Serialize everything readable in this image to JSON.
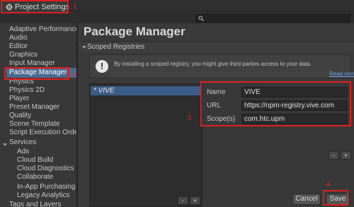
{
  "window": {
    "title": "Project Settings"
  },
  "search": {
    "placeholder": ""
  },
  "sidebar": {
    "items": [
      {
        "label": "Adaptive Performance",
        "sub": false
      },
      {
        "label": "Audio",
        "sub": false
      },
      {
        "label": "Editor",
        "sub": false
      },
      {
        "label": "Graphics",
        "sub": false
      },
      {
        "label": "Input Manager",
        "sub": false
      },
      {
        "label": "Package Manager",
        "sub": false,
        "selected": true
      },
      {
        "label": "Physics",
        "sub": false
      },
      {
        "label": "Physics 2D",
        "sub": false
      },
      {
        "label": "Player",
        "sub": false
      },
      {
        "label": "Preset Manager",
        "sub": false
      },
      {
        "label": "Quality",
        "sub": false
      },
      {
        "label": "Scene Template",
        "sub": false
      },
      {
        "label": "Script Execution Orde",
        "sub": false
      },
      {
        "label": "Services",
        "sub": false,
        "expanded": true
      },
      {
        "label": "Ads",
        "sub": true
      },
      {
        "label": "Cloud Build",
        "sub": true
      },
      {
        "label": "Cloud Diagnostics",
        "sub": true
      },
      {
        "label": "Collaborate",
        "sub": true
      },
      {
        "label": "In-App Purchasing",
        "sub": true
      },
      {
        "label": "Legacy Analytics",
        "sub": true
      },
      {
        "label": "Tags and Layers",
        "sub": false
      }
    ]
  },
  "main": {
    "title": "Package Manager",
    "section_title": "Scoped Registries",
    "info": {
      "icon": "exclamation-icon",
      "text": "By installing a scoped registry, you might give third parties access to your data.",
      "read_more": "Read more"
    },
    "registry_list": {
      "items": [
        "* VIVE"
      ]
    },
    "list_buttons": {
      "remove": "-",
      "add": "+"
    },
    "details": {
      "name_label": "Name",
      "name_value": "VIVE",
      "url_label": "URL",
      "url_value": "https://npm-registry.vive.com",
      "scopes_label": "Scope(s)",
      "scopes_value": "com.htc.upm"
    },
    "scope_buttons": {
      "remove": "-",
      "add": "+"
    },
    "cancel_label": "Cancel",
    "save_label": "Save"
  },
  "annotations": {
    "n1": "1",
    "n2": "2",
    "n3": "3",
    "n4": "4"
  },
  "colors": {
    "annotation_red": "#e01e1e",
    "selection_blue": "#4d6a8e",
    "link_blue": "#6fa2e5"
  }
}
